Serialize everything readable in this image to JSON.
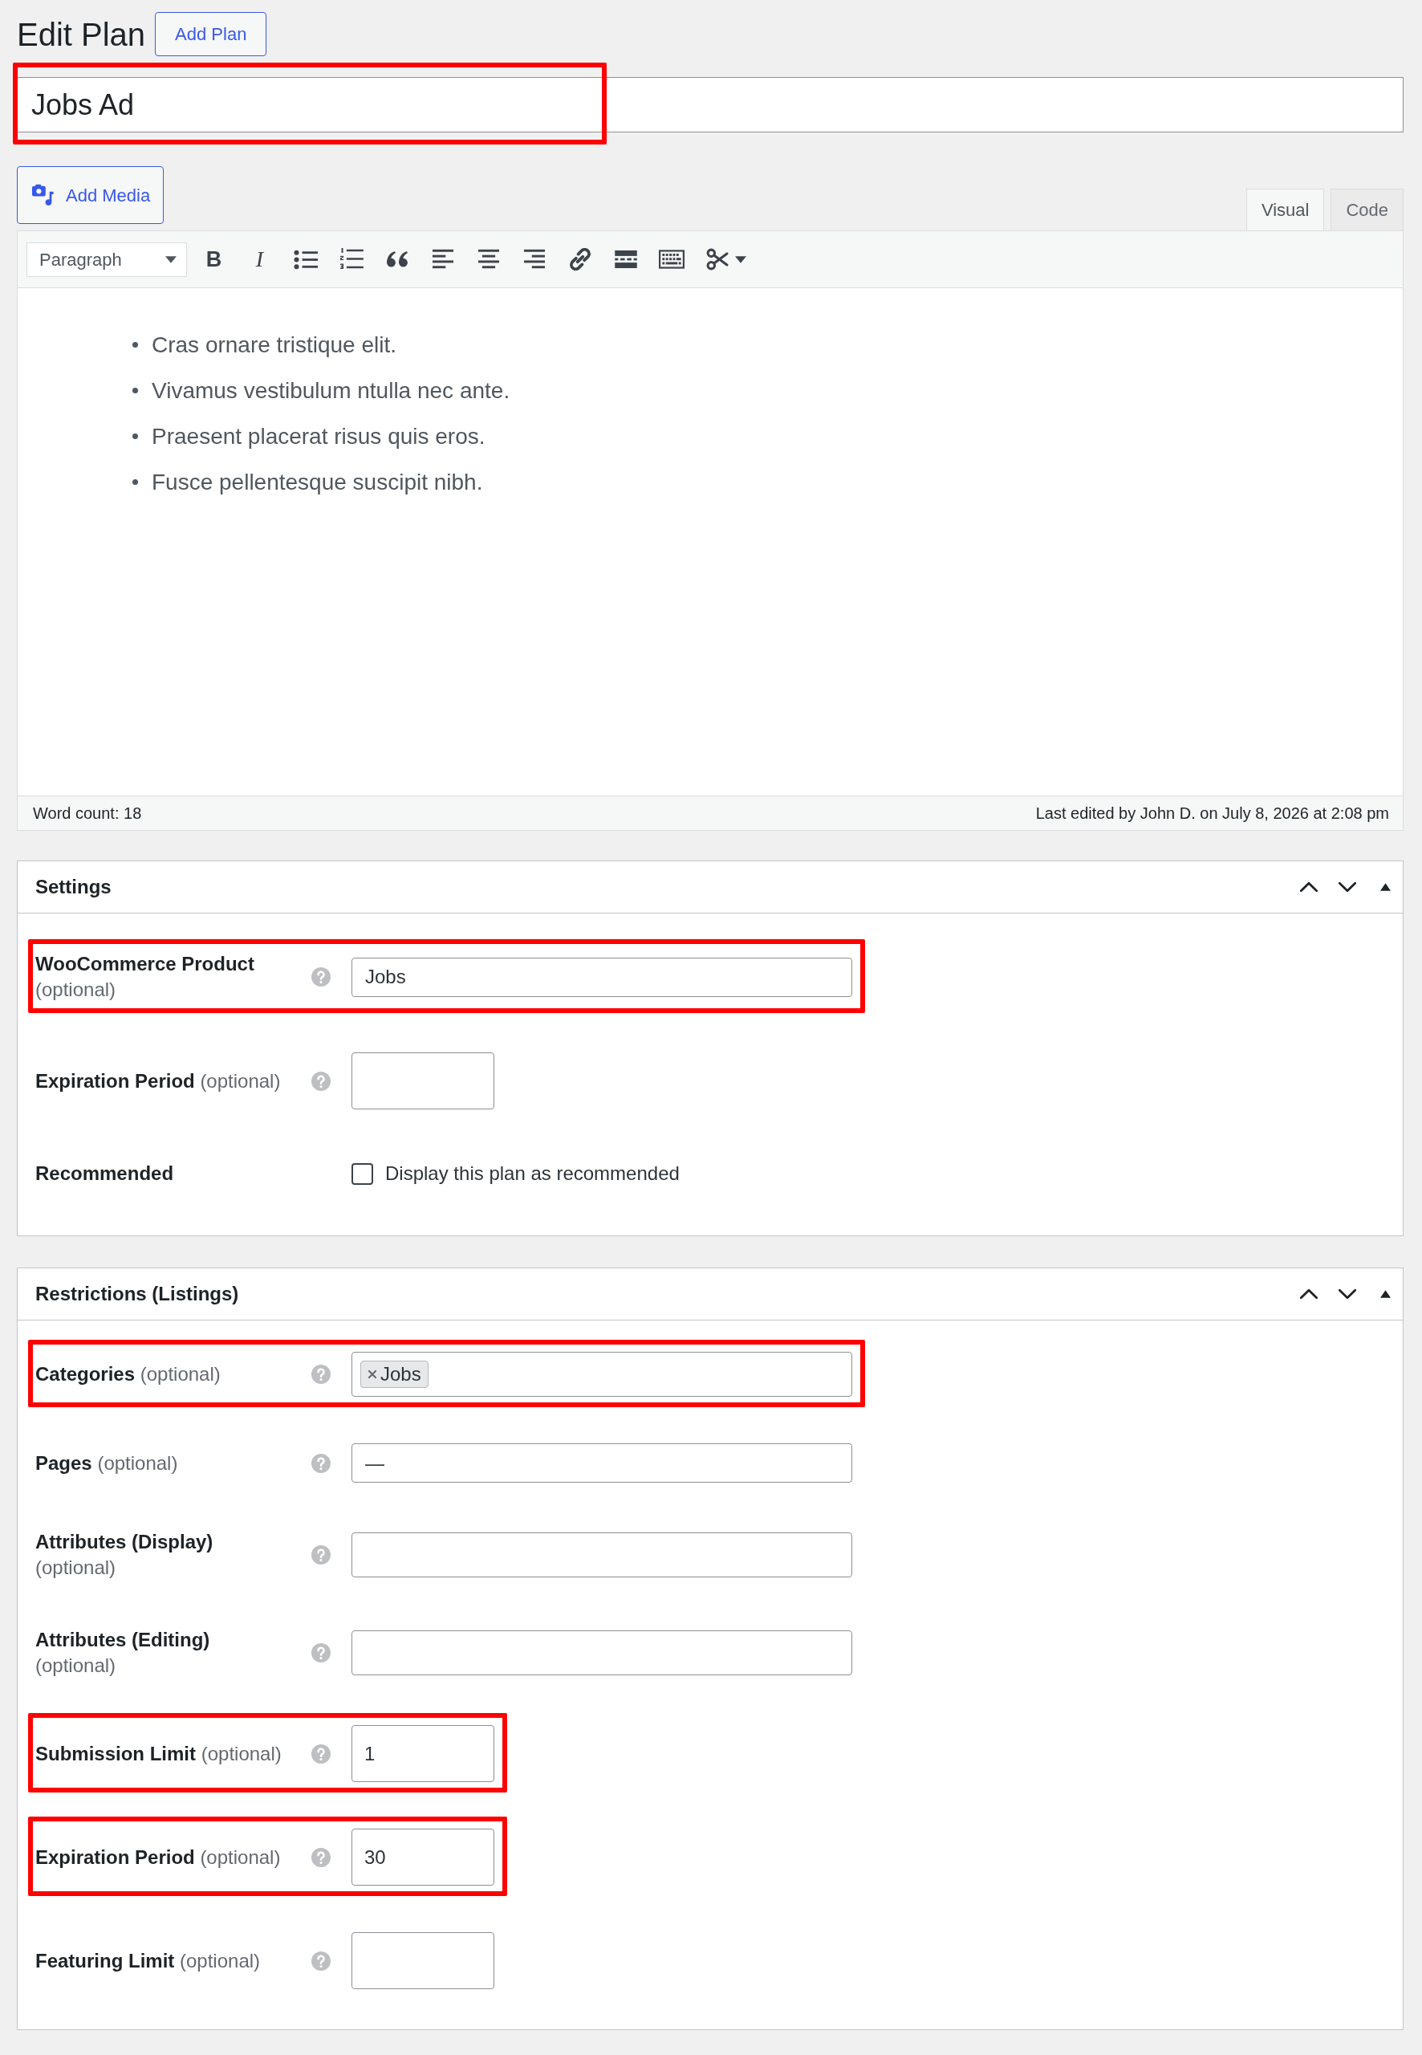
{
  "header": {
    "title": "Edit Plan",
    "button": "Add Plan"
  },
  "title_field": {
    "value": "Jobs Ad",
    "highlighted": true
  },
  "media_button": "Add Media",
  "editor_tabs": [
    {
      "label": "Visual",
      "selected": true
    },
    {
      "label": "Code",
      "selected": false
    }
  ],
  "toolbar": {
    "format": "Paragraph",
    "buttons": [
      {
        "kind": "bold",
        "glyph": "B"
      },
      {
        "kind": "italic",
        "glyph": "I"
      },
      {
        "kind": "bullet-list"
      },
      {
        "kind": "numbered-list"
      },
      {
        "kind": "blockquote"
      },
      {
        "kind": "align-left"
      },
      {
        "kind": "align-center"
      },
      {
        "kind": "align-right"
      },
      {
        "kind": "link"
      },
      {
        "kind": "read-more"
      },
      {
        "kind": "keyboard"
      },
      {
        "kind": "scissors-menu"
      }
    ]
  },
  "editor_content": {
    "list": [
      "Cras ornare tristique elit.",
      "Vivamus vestibulum ntulla nec ante.",
      "Praesent placerat risus quis eros.",
      "Fusce pellentesque suscipit nibh."
    ]
  },
  "status_bar": {
    "word_count": "Word count: 18",
    "last_edited": "Last edited by John D. on July 8, 2026 at 2:08 pm"
  },
  "panels": [
    {
      "title": "Settings",
      "fields": [
        {
          "kind": "text",
          "label": "WooCommerce Product",
          "note": "(optional)",
          "help": true,
          "value": "Jobs",
          "highlighted": true
        },
        {
          "kind": "number",
          "label": "Expiration Period",
          "note": "(optional)",
          "help": true,
          "highlighted": false
        },
        {
          "kind": "checkbox",
          "label": "Recommended",
          "option": "Display this plan as recommended",
          "checked": false,
          "highlighted": false
        }
      ]
    },
    {
      "title": "Restrictions (Listings)",
      "fields": [
        {
          "kind": "tags",
          "label": "Categories",
          "note": "(optional)",
          "help": true,
          "tags": [
            "Jobs"
          ],
          "highlighted": true
        },
        {
          "kind": "text",
          "label": "Pages",
          "note": "(optional)",
          "help": true,
          "value": "—",
          "highlighted": false
        },
        {
          "kind": "tags",
          "label": "Attributes (Display)",
          "note": "(optional)",
          "help": true,
          "highlighted": false
        },
        {
          "kind": "tags",
          "label": "Attributes (Editing)",
          "note": "(optional)",
          "help": true,
          "highlighted": false
        },
        {
          "kind": "number",
          "label": "Submission Limit",
          "note": "(optional)",
          "help": true,
          "value": "1",
          "highlighted": true
        },
        {
          "kind": "number",
          "label": "Expiration Period",
          "note": "(optional)",
          "help": true,
          "value": "30",
          "highlighted": true
        },
        {
          "kind": "number",
          "label": "Featuring Limit",
          "note": "(optional)",
          "help": true,
          "highlighted": false
        }
      ]
    }
  ]
}
